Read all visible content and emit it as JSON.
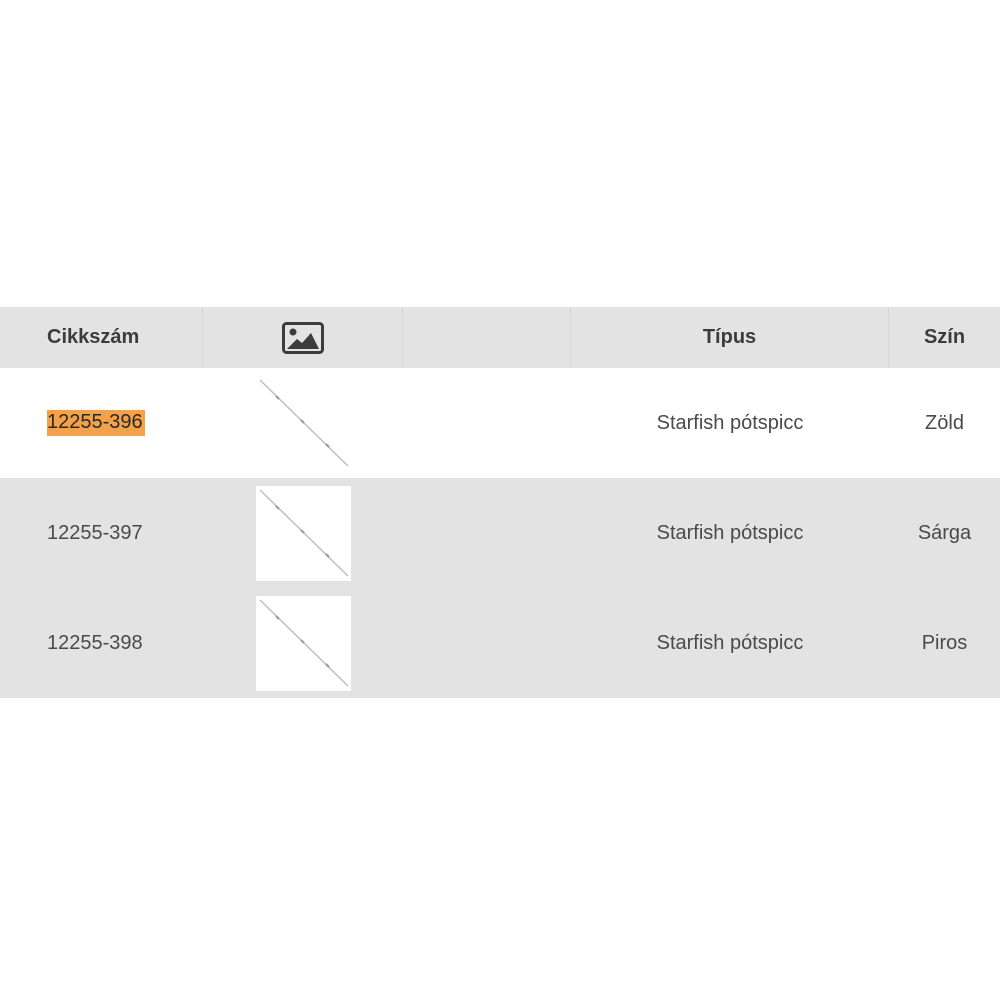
{
  "table": {
    "headers": {
      "code": "Cikkszám",
      "image_icon": "image-icon",
      "type": "Típus",
      "color": "Szín"
    },
    "rows": [
      {
        "code": "12255-396",
        "type": "Starfish pótspicc",
        "color": "Zöld",
        "highlighted": true
      },
      {
        "code": "12255-397",
        "type": "Starfish pótspicc",
        "color": "Sárga",
        "highlighted": false
      },
      {
        "code": "12255-398",
        "type": "Starfish pótspicc",
        "color": "Piros",
        "highlighted": false
      }
    ],
    "colors": {
      "header_bg": "#e3e3e3",
      "alt_row_bg": "#e3e3e3",
      "highlight": "#f3a24a"
    }
  }
}
